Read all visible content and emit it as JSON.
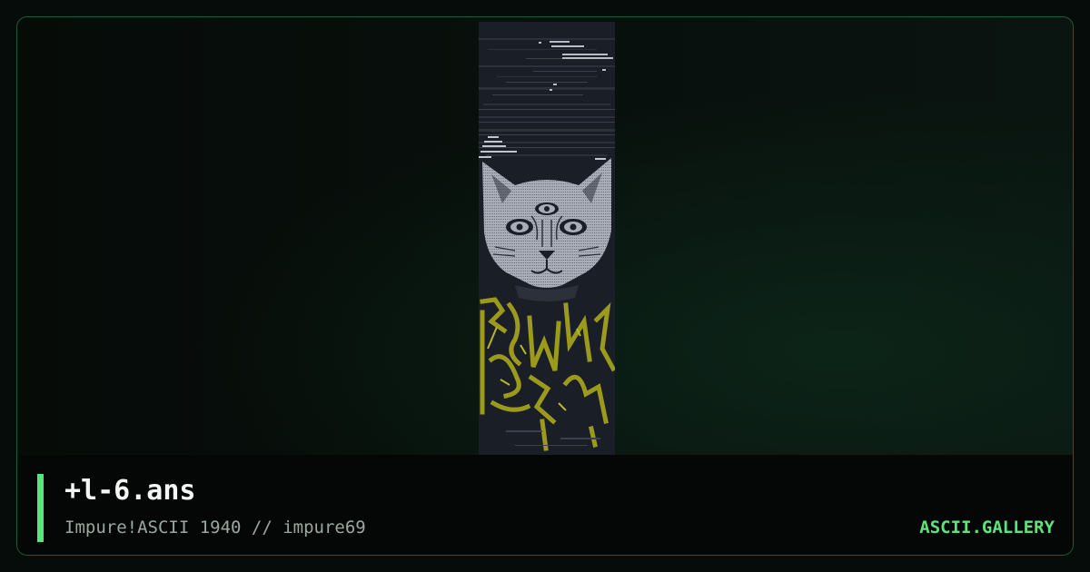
{
  "artwork": {
    "filename": "+l-6.ans",
    "meta": "Impure!ASCII 1940 // impure69",
    "site": "ASCII.GALLERY"
  },
  "colors": {
    "accent": "#5ce47b",
    "border": "#1f5d2c",
    "panel_background": "#1a1e26",
    "art_gray": "#a9adb8",
    "art_yellow": "#9c9a1c"
  }
}
